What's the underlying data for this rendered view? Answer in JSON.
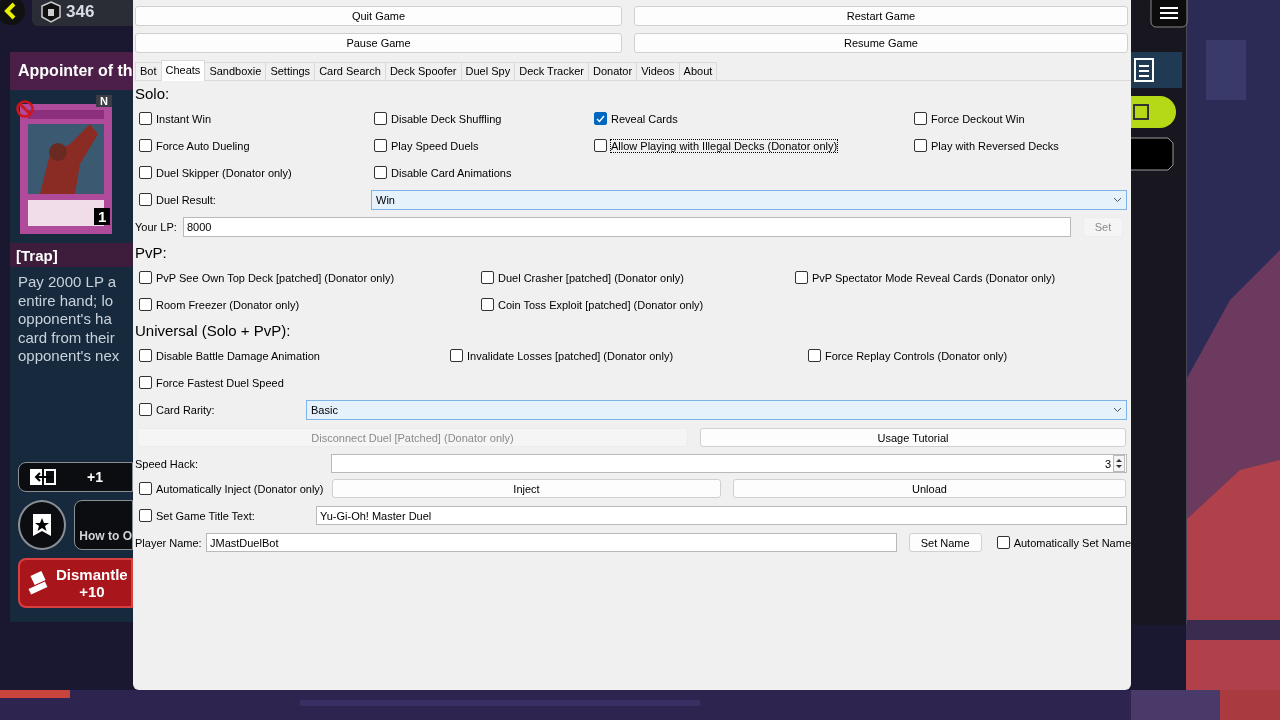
{
  "game": {
    "cp_count": "346",
    "card_title": "Appointer of th",
    "rarity": "N",
    "card_count": "1",
    "card_type": "[Trap]",
    "description": [
      "Pay 2000 LP a",
      "entire hand; lo",
      "opponent's ha",
      "card from their",
      "opponent's nex"
    ],
    "convert_count": "+1",
    "how_to_label": "How to O",
    "dismantle_label": "Dismantle",
    "dismantle_value": "+10"
  },
  "window": {
    "top_buttons": [
      {
        "label": "Quit Game",
        "disabled": false
      },
      {
        "label": "Restart Game",
        "disabled": false
      },
      {
        "label": "Pause Game",
        "disabled": false
      },
      {
        "label": "Resume Game",
        "disabled": false
      }
    ],
    "tabs": [
      {
        "label": "Bot",
        "selected": false
      },
      {
        "label": "Cheats",
        "selected": true
      },
      {
        "label": "Sandboxie",
        "selected": false
      },
      {
        "label": "Settings",
        "selected": false
      },
      {
        "label": "Card Search",
        "selected": false
      },
      {
        "label": "Deck Spoofer",
        "selected": false
      },
      {
        "label": "Duel Spy",
        "selected": false
      },
      {
        "label": "Deck Tracker",
        "selected": false
      },
      {
        "label": "Donator",
        "selected": false
      },
      {
        "label": "Videos",
        "selected": false
      },
      {
        "label": "About",
        "selected": false
      }
    ],
    "solo": {
      "heading": "Solo:",
      "rows": [
        [
          {
            "label": "Instant Win",
            "checked": false,
            "focused": false
          },
          {
            "label": "Disable Deck Shuffling",
            "checked": false,
            "focused": false
          },
          {
            "label": "Reveal Cards",
            "checked": true,
            "focused": false
          },
          {
            "label": "Force Deckout Win",
            "checked": false,
            "focused": false
          }
        ],
        [
          {
            "label": "Force Auto Dueling",
            "checked": false,
            "focused": false
          },
          {
            "label": "Play Speed Duels",
            "checked": false,
            "focused": false
          },
          {
            "label": "Allow Playing with Illegal Decks (Donator only)",
            "checked": false,
            "focused": true
          },
          {
            "label": "Play with Reversed Decks",
            "checked": false,
            "focused": false
          }
        ],
        [
          {
            "label": "Duel Skipper (Donator only)",
            "checked": false,
            "focused": false
          },
          {
            "label": "Disable Card Animations",
            "checked": false,
            "focused": false
          }
        ]
      ],
      "duel_result": {
        "label": "Duel Result:",
        "checked": false,
        "value": "Win"
      },
      "your_lp": {
        "label": "Your LP:",
        "value": "8000",
        "button": {
          "label": "Set",
          "disabled": true
        }
      }
    },
    "pvp": {
      "heading": "PvP:",
      "rows": [
        [
          {
            "label": "PvP See Own Top Deck [patched] (Donator only)",
            "checked": false,
            "focused": false
          },
          {
            "label": "Duel Crasher [patched] (Donator only)",
            "checked": false,
            "focused": false
          },
          {
            "label": "PvP Spectator Mode Reveal Cards (Donator only)",
            "checked": false,
            "focused": false
          }
        ],
        [
          {
            "label": "Room Freezer (Donator only)",
            "checked": false,
            "focused": false
          },
          {
            "label": "Coin Toss Exploit [patched] (Donator only)",
            "checked": false,
            "focused": false
          }
        ]
      ]
    },
    "universal": {
      "heading": "Universal (Solo + PvP):",
      "rows": [
        [
          {
            "label": "Disable Battle Damage Animation",
            "checked": false,
            "focused": false
          },
          {
            "label": "Invalidate Losses [patched] (Donator only)",
            "checked": false,
            "focused": false
          },
          {
            "label": "Force Replay Controls (Donator only)",
            "checked": false,
            "focused": false
          }
        ],
        [
          {
            "label": "Force Fastest Duel Speed",
            "checked": false,
            "focused": false
          }
        ]
      ],
      "card_rarity": {
        "label": "Card Rarity:",
        "checked": false,
        "value": "Basic"
      }
    },
    "disconnect_button": {
      "label": "Disconnect Duel [Patched] (Donator only)",
      "disabled": true
    },
    "tutorial_button": {
      "label": "Usage Tutorial",
      "disabled": false
    },
    "speed_hack": {
      "label": "Speed Hack:",
      "value": "3"
    },
    "auto_inject": {
      "label": "Automatically Inject (Donator only)",
      "checked": false
    },
    "inject_button": {
      "label": "Inject",
      "disabled": false
    },
    "unload_button": {
      "label": "Unload",
      "disabled": false
    },
    "game_title": {
      "label": "Set Game Title Text:",
      "checked": false,
      "value": "Yu-Gi-Oh! Master Duel"
    },
    "player_name": {
      "label": "Player Name:",
      "value": "JMastDuelBot"
    },
    "set_name_button": {
      "label": "Set Name",
      "disabled": false
    },
    "auto_set_name": {
      "label": "Automatically Set Name",
      "checked": false
    }
  }
}
